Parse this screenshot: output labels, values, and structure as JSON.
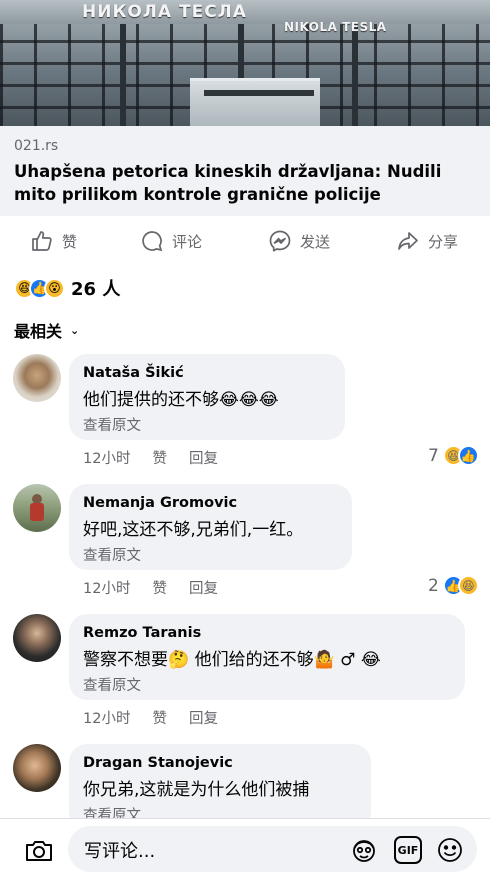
{
  "post": {
    "link_domain": "021.rs",
    "link_title": "Uhapšena petorica kineskih državljana: Nudili mito prilikom kontrole granične policije",
    "hero_sign_1": "НИКОЛА ТЕСЛА",
    "hero_sign_2": "NIKOLA TESLA"
  },
  "actions": {
    "like": "赞",
    "comment": "评论",
    "send": "发送",
    "share": "分享"
  },
  "reactions_summary": {
    "count_label": "26 人",
    "icons": [
      "haha",
      "like",
      "wow"
    ]
  },
  "sort_label": "最相关",
  "comments": [
    {
      "author": "Nataša Šikić",
      "text": "他们提供的还不够",
      "emoji_tail": [
        "😂",
        "😂",
        "😂"
      ],
      "see_original": "查看原文",
      "time": "12小时",
      "like": "赞",
      "reply": "回复",
      "reaction_count": "7",
      "reaction_icons": [
        "haha",
        "like"
      ]
    },
    {
      "author": "Nemanja Gromovic",
      "text": "好吧,这还不够,兄弟们,一红。",
      "see_original": "查看原文",
      "time": "12小时",
      "like": "赞",
      "reply": "回复",
      "reaction_count": "2",
      "reaction_icons": [
        "like",
        "haha"
      ]
    },
    {
      "author": "Remzo Taranis",
      "text_a": "警察不想要",
      "emoji_a": "🤔",
      "text_b": "他们给的还不够",
      "emoji_b": "🤷",
      "text_c": "♂",
      "emoji_c": "😂",
      "see_original": "查看原文",
      "time": "12小时",
      "like": "赞",
      "reply": "回复"
    },
    {
      "author": "Dragan Stanojevic",
      "text": "你兄弟,这就是为什么他们被捕",
      "see_original": "查看原文"
    }
  ],
  "composer": {
    "placeholder": "写评论...",
    "gif_label": "GIF"
  },
  "colors": {
    "bubble": "#f0f2f5",
    "secondary_text": "#65676b",
    "like_blue": "#1877f2",
    "haha_yellow": "#f7b928"
  }
}
